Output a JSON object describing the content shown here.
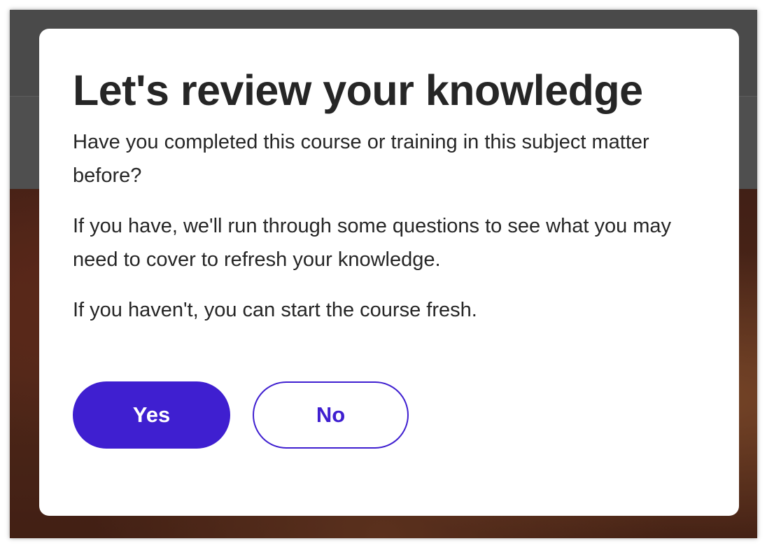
{
  "dialog": {
    "title": "Let's review your knowledge",
    "paragraphs": [
      "Have you completed this course or training in this subject matter before?",
      "If you have, we'll run through some questions to see what you may need to cover to refresh your knowledge.",
      "If you haven't, you can start the course fresh."
    ],
    "yes_label": "Yes",
    "no_label": "No"
  },
  "colors": {
    "accent": "#3f1fd0",
    "text": "#262626",
    "overlay": "#4d4d4d"
  }
}
